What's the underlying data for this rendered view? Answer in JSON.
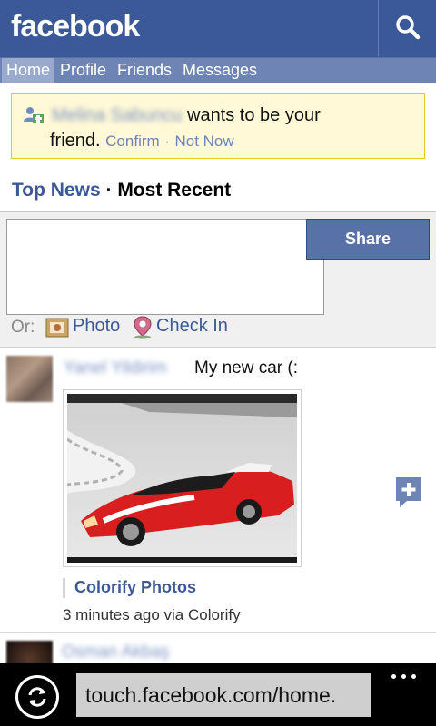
{
  "header": {
    "logo": "facebook",
    "search_icon": "search-icon"
  },
  "nav": {
    "items": [
      {
        "label": "Home",
        "active": true
      },
      {
        "label": "Profile",
        "active": false
      },
      {
        "label": "Friends",
        "active": false
      },
      {
        "label": "Messages",
        "active": false
      }
    ]
  },
  "friend_request": {
    "icon": "friend-request-icon",
    "name": "Melina Sabuncu",
    "text_1": "wants to be your",
    "text_2": "friend.",
    "confirm": "Confirm",
    "separator": "·",
    "not_now": "Not Now"
  },
  "feed_filter": {
    "top_news": "Top News",
    "separator": "·",
    "most_recent": "Most Recent"
  },
  "composer": {
    "share": "Share",
    "or_label": "Or:",
    "photo": "Photo",
    "check_in": "Check In"
  },
  "stories": [
    {
      "author": "Yanel Yildirim",
      "message": "My new car (:",
      "app_link": "Colorify Photos",
      "timestamp": "3 minutes ago via Colorify",
      "comment_icon": "comment-add-icon"
    },
    {
      "author": "Osman Akbaş"
    }
  ],
  "browser": {
    "url": "touch.facebook.com/home.",
    "refresh_icon": "refresh-icon",
    "more_icon": "more-icon"
  },
  "colors": {
    "brand": "#3b5998",
    "nav": "#6d84b4",
    "request_bg": "#fff9d7"
  }
}
